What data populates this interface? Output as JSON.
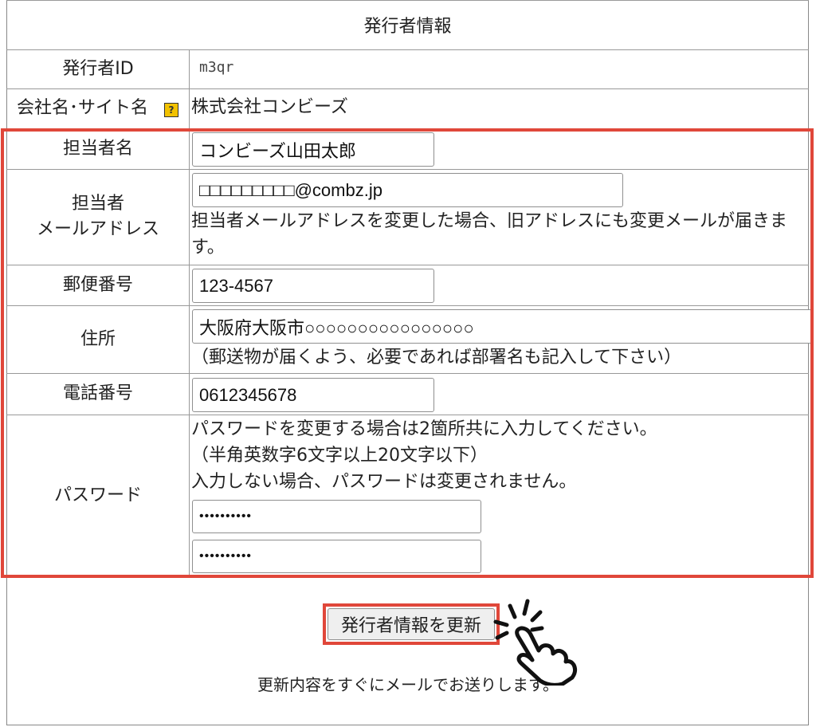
{
  "form": {
    "title": "発行者情報",
    "publisher_id_label": "発行者ID",
    "publisher_id_value": "m3qr",
    "company_label": "会社名･サイト名",
    "help_icon_glyph": "?",
    "company_value": "株式会社コンビーズ",
    "contact_name_label": "担当者名",
    "contact_name_value": "コンビーズ山田太郎",
    "email_label_line1": "担当者",
    "email_label_line2": "メールアドレス",
    "email_value": "□□□□□□□□□@combz.jp",
    "email_note_line1": "担当者メールアドレスを変更した場合、旧アドレスにも変更メールが届きま",
    "email_note_line2": "す。",
    "postal_label": "郵便番号",
    "postal_value": "123-4567",
    "address_label": "住所",
    "address_value": "大阪府大阪市○○○○○○○○○○○○○○○○",
    "address_note": "（郵送物が届くよう、必要であれば部署名も記入して下さい）",
    "phone_label": "電話番号",
    "phone_value": "0612345678",
    "password_label": "パスワード",
    "password_note_line1": "パスワードを変更する場合は2箇所共に入力してください。",
    "password_note_line2": "（半角英数字6文字以上20文字以下）",
    "password_note_line3": "入力しない場合、パスワードは変更されません。",
    "password_value": "••••••••••",
    "password_confirm_value": "••••••••••",
    "submit_label": "発行者情報を更新",
    "footer_note": "更新内容をすぐにメールでお送りします。"
  },
  "colors": {
    "highlight": "#e0473a",
    "help_icon": "#f2c200"
  },
  "icons": {
    "help": "help-icon",
    "cursor": "pointing-hand-icon"
  }
}
